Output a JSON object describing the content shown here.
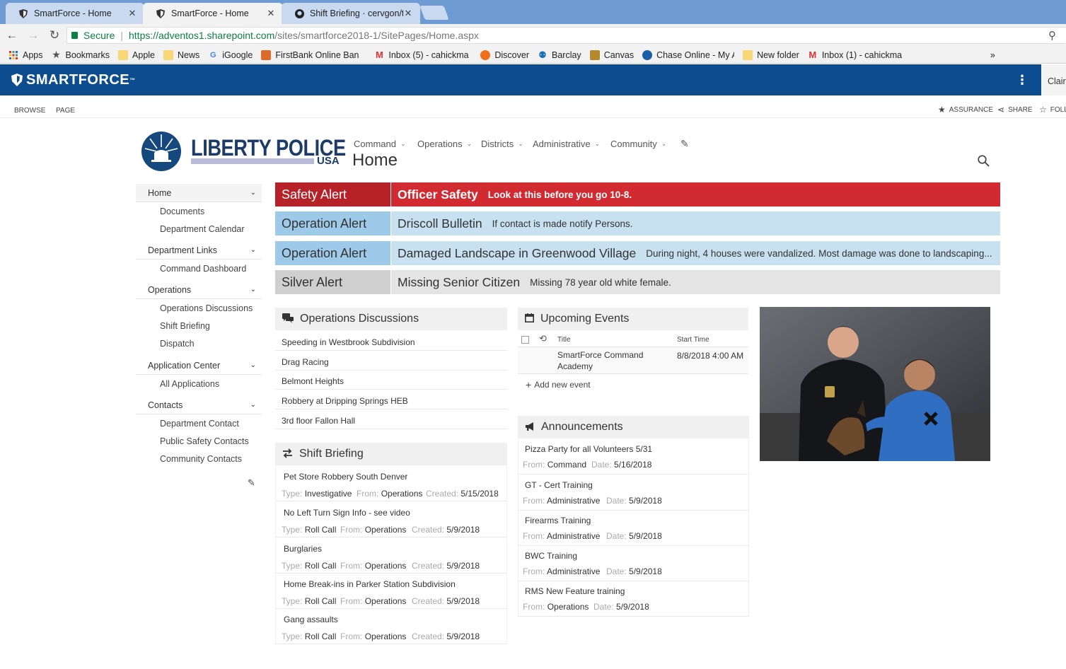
{
  "browser": {
    "tabs": [
      {
        "title": "SmartForce - Home",
        "icon": "shield-icon"
      },
      {
        "title": "SmartForce - Home",
        "icon": "shield-icon"
      },
      {
        "title": "Shift Briefing · cervgon/te",
        "icon": "github-icon"
      }
    ],
    "close_glyph": "✕",
    "address": {
      "secure_label": "Secure",
      "url_host": "https://adventos1.sharepoint.com",
      "url_path": "/sites/smartforce2018-1/SitePages/Home.aspx"
    },
    "bookmarks": [
      {
        "label": "Apps",
        "icon": "apps-grid-icon"
      },
      {
        "label": "Bookmarks",
        "icon": "star-icon"
      },
      {
        "label": "Apple",
        "icon": "folder-icon"
      },
      {
        "label": "News",
        "icon": "folder-icon"
      },
      {
        "label": "iGoogle",
        "icon": "google-icon"
      },
      {
        "label": "FirstBank Online Ban",
        "icon": "bank-icon"
      },
      {
        "label": "Inbox (5) - cahickma",
        "icon": "gmail-icon"
      },
      {
        "label": "Discover",
        "icon": "discover-icon"
      },
      {
        "label": "Barclay",
        "icon": "barclay-icon"
      },
      {
        "label": "Canvas",
        "icon": "canvas-icon"
      },
      {
        "label": "Chase Online - My A",
        "icon": "chase-icon"
      },
      {
        "label": "New folder",
        "icon": "folder-icon"
      },
      {
        "label": "Inbox (1) - cahickma",
        "icon": "gmail-icon"
      }
    ],
    "bookmarks_overflow": "»"
  },
  "suite": {
    "logo": "SMARTFORCE",
    "user": "Claire"
  },
  "ribbon": {
    "tabs": [
      "BROWSE",
      "PAGE"
    ],
    "actions": [
      "ASSURANCE",
      "SHARE",
      "FOLL"
    ]
  },
  "site": {
    "title": "LIBERTY POLICE",
    "subtitle": "USA",
    "page_title": "Home",
    "topnav": [
      "Command",
      "Operations",
      "Districts",
      "Administrative",
      "Community"
    ]
  },
  "leftnav": {
    "sections": [
      {
        "header": "Home",
        "items": [
          "Documents",
          "Department Calendar"
        ]
      },
      {
        "header": "Department Links",
        "items": [
          "Command Dashboard"
        ]
      },
      {
        "header": "Operations",
        "items": [
          "Operations Discussions",
          "Shift Briefing",
          "Dispatch"
        ]
      },
      {
        "header": "Application Center",
        "items": [
          "All Applications"
        ]
      },
      {
        "header": "Contacts",
        "items": [
          "Department Contact",
          "Public Safety Contacts",
          "Community Contacts"
        ]
      }
    ]
  },
  "alerts": [
    {
      "type": "Safety Alert",
      "title": "Officer Safety",
      "desc": "Look at this before you go 10-8.",
      "bg": "#d12a31",
      "type_bg": "#b62228",
      "fg": "#ffffff"
    },
    {
      "type": "Operation Alert",
      "title": "Driscoll Bulletin",
      "desc": "If contact is made notify Persons.",
      "bg": "#c8e1f1",
      "type_bg": "#9ccae8",
      "fg": "#333333"
    },
    {
      "type": "Operation Alert",
      "title": "Damaged Landscape in Greenwood Village",
      "desc": "During night, 4 houses were vandalized. Most damage was done to landscaping...",
      "bg": "#c8e1f1",
      "type_bg": "#9ccae8",
      "fg": "#333333"
    },
    {
      "type": "Silver Alert",
      "title": "Missing Senior Citizen",
      "desc": "Missing 78 year old white female.",
      "bg": "#e4e4e4",
      "type_bg": "#cfcfcf",
      "fg": "#333333"
    }
  ],
  "discussions": {
    "title": "Operations Discussions",
    "items": [
      "Speeding in Westbrook Subdivision",
      "Drag Racing",
      "Belmont Heights",
      "Robbery at Dripping Springs HEB",
      "3rd floor Fallon Hall"
    ]
  },
  "shift_briefing": {
    "title": "Shift Briefing",
    "labels": {
      "type": "Type:",
      "from": "From:",
      "created": "Created:"
    },
    "items": [
      {
        "title": "Pet Store Robbery South Denver",
        "type": "Investigative",
        "from": "Operations",
        "created": "5/15/2018"
      },
      {
        "title": "No Left Turn Sign Info - see video",
        "type": "Roll Call",
        "from": "Operations",
        "created": "5/9/2018"
      },
      {
        "title": "Burglaries",
        "type": "Roll Call",
        "from": "Operations",
        "created": "5/9/2018"
      },
      {
        "title": "Home Break-ins in Parker Station Subdivision",
        "type": "Roll Call",
        "from": "Operations",
        "created": "5/9/2018"
      },
      {
        "title": "Gang assaults",
        "type": "Roll Call",
        "from": "Operations",
        "created": "5/9/2018"
      }
    ]
  },
  "events": {
    "title": "Upcoming Events",
    "columns": [
      "Title",
      "Start Time"
    ],
    "rows": [
      {
        "title_line1": "SmartForce Command",
        "title_line2": "Academy",
        "start": "8/8/2018 4:00 AM"
      }
    ],
    "add_label": "Add new event"
  },
  "announcements": {
    "title": "Announcements",
    "labels": {
      "from": "From:",
      "date": "Date:"
    },
    "items": [
      {
        "title": "Pizza Party for all Volunteers 5/31",
        "from": "Command",
        "date": "5/16/2018"
      },
      {
        "title": "GT - Cert Training",
        "from": "Administrative",
        "date": "5/9/2018"
      },
      {
        "title": "Firearms Training",
        "from": "Administrative",
        "date": "5/9/2018"
      },
      {
        "title": "BWC Training",
        "from": "Administrative",
        "date": "5/9/2018"
      },
      {
        "title": "RMS New Feature training",
        "from": "Operations",
        "date": "5/9/2018"
      }
    ]
  },
  "colors": {
    "suite_blue": "#0d4d8f",
    "safety_red": "#d12a31",
    "operation_blue": "#c8e1f1"
  }
}
